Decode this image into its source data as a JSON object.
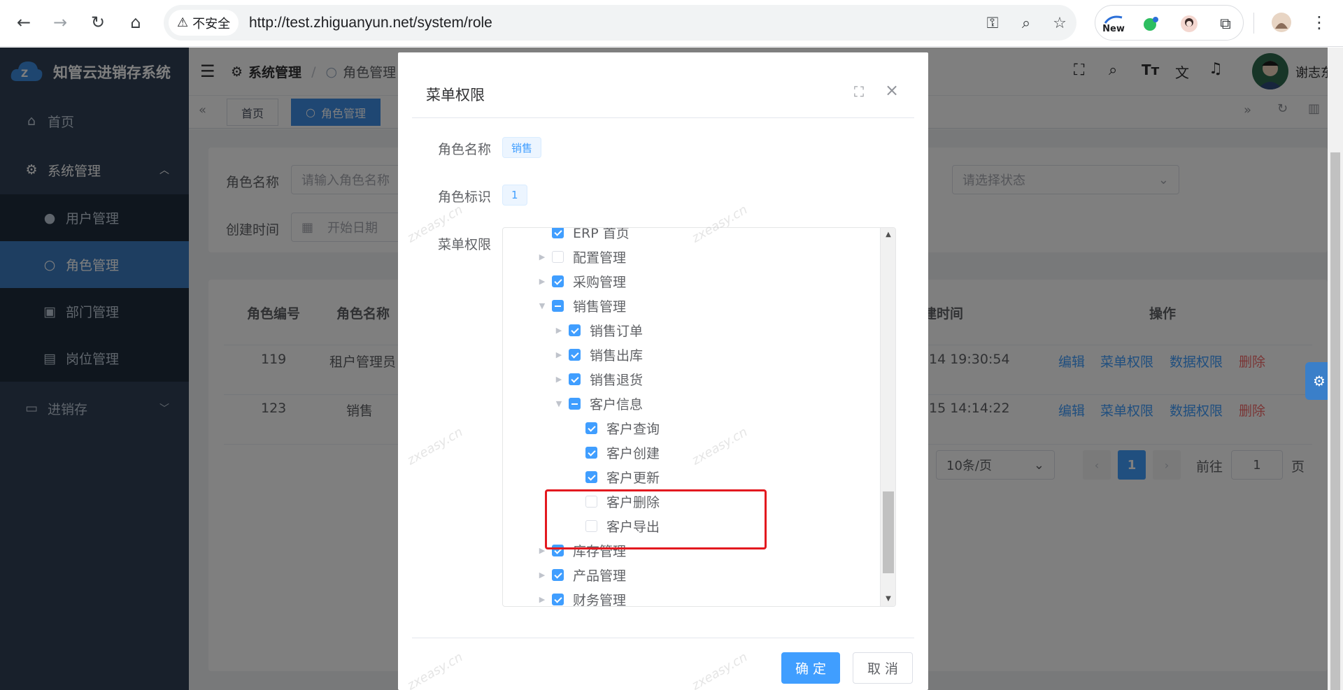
{
  "browser": {
    "security_label": "不安全",
    "url": "http://test.zhiguanyun.net/system/role",
    "ext_new_label": "New"
  },
  "app": {
    "logo_text": "知管云进销存系统",
    "sidebar": {
      "home": "首页",
      "system": "系统管理",
      "users": "用户管理",
      "roles": "角色管理",
      "depts": "部门管理",
      "posts": "岗位管理",
      "erp": "进销存"
    },
    "breadcrumb": {
      "root": "系统管理",
      "sep": "/",
      "current": "角色管理"
    },
    "user_name": "谢志东",
    "tags": {
      "home": "首页",
      "roles": "角色管理"
    }
  },
  "search_form": {
    "role_name_label": "角色名称",
    "role_name_placeholder": "请输入角色名称",
    "status_placeholder": "请选择状态",
    "created_label": "创建时间",
    "start_date_placeholder": "开始日期"
  },
  "table": {
    "headers": {
      "id": "角色编号",
      "name": "角色名称",
      "created": "建时间",
      "ops": "操作"
    },
    "rows": [
      {
        "id": "119",
        "name": "租户管理员",
        "created": "14 19:30:54"
      },
      {
        "id": "123",
        "name": "销售",
        "created": "15 14:14:22"
      }
    ],
    "actions": {
      "edit": "编辑",
      "menu_perm": "菜单权限",
      "data_perm": "数据权限",
      "delete": "删除"
    }
  },
  "pagination": {
    "page_size": "10条/页",
    "current": "1",
    "goto_label": "前往",
    "goto_value": "1",
    "page_suffix": "页"
  },
  "dialog": {
    "title": "菜单权限",
    "role_name_label": "角色名称",
    "role_name_value": "销售",
    "role_key_label": "角色标识",
    "role_key_value": "1",
    "menu_perm_label": "菜单权限",
    "tree": [
      {
        "label": "ERP 首页",
        "state": "checked"
      },
      {
        "label": "配置管理",
        "state": "unchecked"
      },
      {
        "label": "采购管理",
        "state": "checked"
      },
      {
        "label": "销售管理",
        "state": "half"
      },
      {
        "label": "销售订单",
        "state": "checked"
      },
      {
        "label": "销售出库",
        "state": "checked"
      },
      {
        "label": "销售退货",
        "state": "checked"
      },
      {
        "label": "客户信息",
        "state": "half"
      },
      {
        "label": "客户查询",
        "state": "checked"
      },
      {
        "label": "客户创建",
        "state": "checked"
      },
      {
        "label": "客户更新",
        "state": "checked"
      },
      {
        "label": "客户删除",
        "state": "unchecked"
      },
      {
        "label": "客户导出",
        "state": "unchecked"
      },
      {
        "label": "库存管理",
        "state": "checked"
      },
      {
        "label": "产品管理",
        "state": "checked"
      },
      {
        "label": "财务管理",
        "state": "checked"
      }
    ],
    "confirm": "确 定",
    "cancel": "取 消"
  },
  "watermark": "zxeasy.cn",
  "colors": {
    "sidebar_bg": "#304156",
    "primary": "#409eff",
    "danger": "#f56c6c",
    "highlight_border": "#e3191f"
  }
}
